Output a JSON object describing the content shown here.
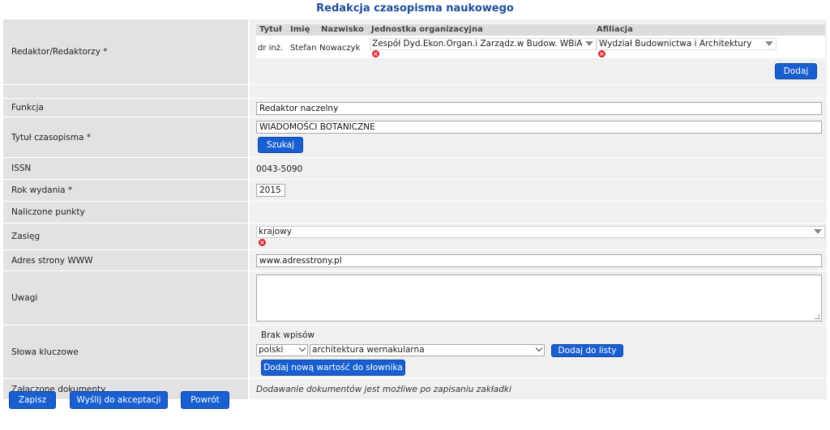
{
  "page": {
    "title": "Redakcja czasopisma naukowego"
  },
  "editors": {
    "label": "Redaktor/Redaktorzy *",
    "columns": [
      "Tytuł",
      "Imię",
      "Nazwisko",
      "Jednostka organizacyjna",
      "Afiliacja"
    ],
    "rows": [
      {
        "title": "dr inż.",
        "first_name": "Stefan",
        "last_name": "Nowaczyk",
        "unit": "Zespół Dyd.Ekon.Organ.i Zarządz.w Budow. WBiA",
        "affiliation": "Wydział Budownictwa i Architektury"
      }
    ],
    "add_label": "Dodaj"
  },
  "fields": {
    "function": {
      "label": "Funkcja",
      "value": "Redaktor naczelny"
    },
    "journal_title": {
      "label": "Tytuł czasopisma *",
      "value": "WIADOMOŚCI BOTANICZNE",
      "search_label": "Szukaj"
    },
    "issn": {
      "label": "ISSN",
      "value": "0043-5090"
    },
    "year": {
      "label": "Rok wydania *",
      "value": "2015"
    },
    "points": {
      "label": "Naliczone punkty",
      "value": ""
    },
    "scope": {
      "label": "Zasięg",
      "value": "krajowy"
    },
    "website": {
      "label": "Adres strony WWW",
      "value": "www.adresstrony.pl"
    },
    "notes": {
      "label": "Uwagi",
      "value": ""
    },
    "keywords": {
      "label": "Słowa kluczowe",
      "empty_text": "Brak wpisów",
      "language": "polski",
      "keyword": "architektura wernakularna",
      "add_to_list_label": "Dodaj do listy",
      "add_dict_label": "Dodaj nową wartość do słownika"
    },
    "attachments": {
      "label": "Załączone dokumenty",
      "note": "Dodawanie dokumentów jest możliwe po zapisaniu zakładki"
    }
  },
  "footer": {
    "save": "Zapisz",
    "send": "Wyślij do akceptacji",
    "back": "Powrót"
  },
  "colors": {
    "accent": "#1a5fcf",
    "label_bg": "#e2e2e2",
    "value_bg": "#f0f0f0",
    "title": "#1f4e9a",
    "remove": "#d9232e"
  }
}
